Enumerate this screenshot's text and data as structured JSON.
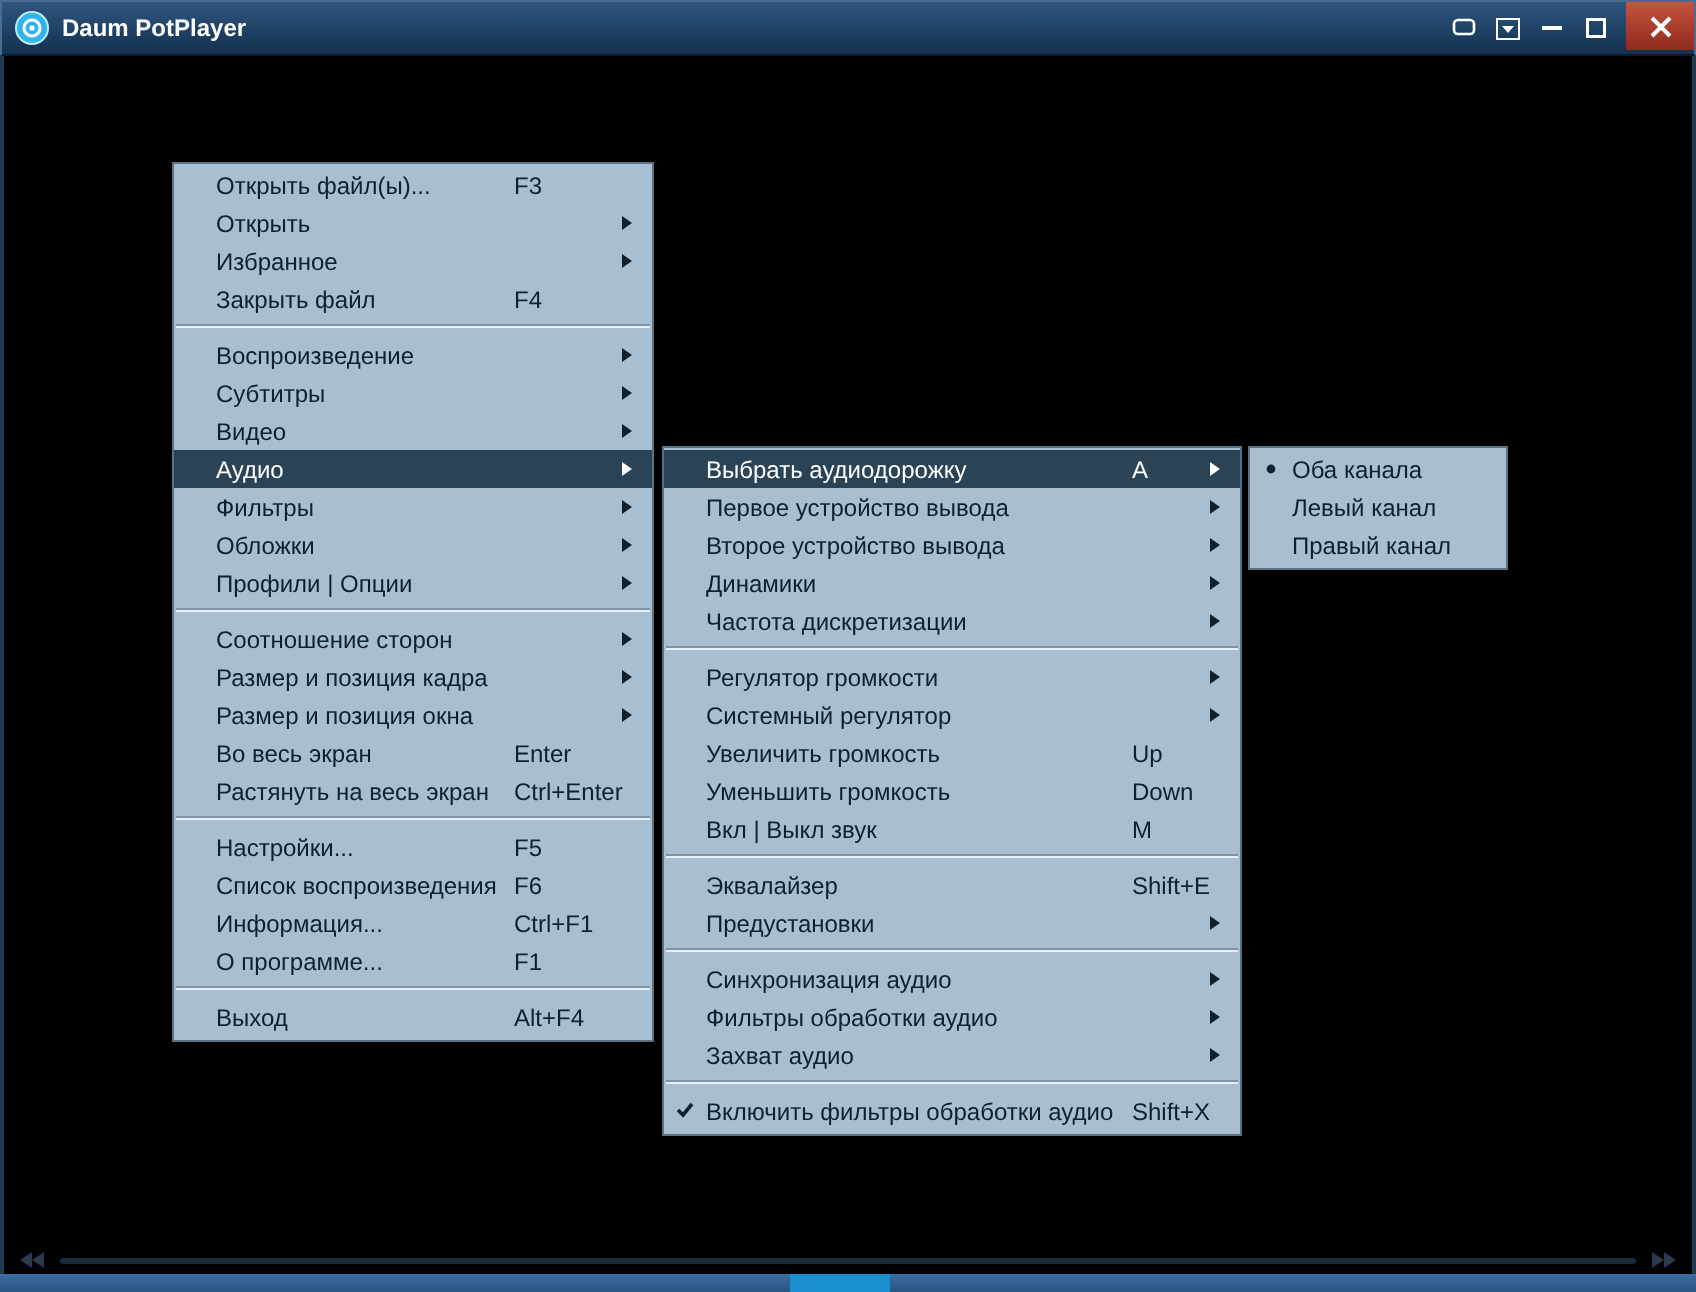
{
  "window": {
    "title": "Daum PotPlayer"
  },
  "main_menu": [
    {
      "kind": "item",
      "label": "Открыть файл(ы)...",
      "shortcut": "F3",
      "has_submenu": false,
      "selected": false
    },
    {
      "kind": "item",
      "label": "Открыть",
      "has_submenu": true,
      "selected": false
    },
    {
      "kind": "item",
      "label": "Избранное",
      "has_submenu": true,
      "selected": false
    },
    {
      "kind": "item",
      "label": "Закрыть файл",
      "shortcut": "F4",
      "has_submenu": false,
      "selected": false
    },
    {
      "kind": "separator"
    },
    {
      "kind": "item",
      "label": "Воспроизведение",
      "has_submenu": true,
      "selected": false
    },
    {
      "kind": "item",
      "label": "Субтитры",
      "has_submenu": true,
      "selected": false
    },
    {
      "kind": "item",
      "label": "Видео",
      "has_submenu": true,
      "selected": false
    },
    {
      "kind": "item",
      "label": "Аудио",
      "has_submenu": true,
      "selected": true
    },
    {
      "kind": "item",
      "label": "Фильтры",
      "has_submenu": true,
      "selected": false
    },
    {
      "kind": "item",
      "label": "Обложки",
      "has_submenu": true,
      "selected": false
    },
    {
      "kind": "item",
      "label": "Профили | Опции",
      "has_submenu": true,
      "selected": false
    },
    {
      "kind": "separator"
    },
    {
      "kind": "item",
      "label": "Соотношение сторон",
      "has_submenu": true,
      "selected": false
    },
    {
      "kind": "item",
      "label": "Размер и позиция кадра",
      "has_submenu": true,
      "selected": false
    },
    {
      "kind": "item",
      "label": "Размер и позиция окна",
      "has_submenu": true,
      "selected": false
    },
    {
      "kind": "item",
      "label": "Во весь экран",
      "shortcut": "Enter",
      "has_submenu": false,
      "selected": false
    },
    {
      "kind": "item",
      "label": "Растянуть на весь экран",
      "shortcut": "Ctrl+Enter",
      "has_submenu": false,
      "selected": false
    },
    {
      "kind": "separator"
    },
    {
      "kind": "item",
      "label": "Настройки...",
      "shortcut": "F5",
      "has_submenu": false,
      "selected": false
    },
    {
      "kind": "item",
      "label": "Список воспроизведения",
      "shortcut": "F6",
      "has_submenu": false,
      "selected": false
    },
    {
      "kind": "item",
      "label": "Информация...",
      "shortcut": "Ctrl+F1",
      "has_submenu": false,
      "selected": false
    },
    {
      "kind": "item",
      "label": "О программе...",
      "shortcut": "F1",
      "has_submenu": false,
      "selected": false
    },
    {
      "kind": "separator"
    },
    {
      "kind": "item",
      "label": "Выход",
      "shortcut": "Alt+F4",
      "has_submenu": false,
      "selected": false
    }
  ],
  "audio_menu": [
    {
      "kind": "item",
      "label": "Выбрать аудиодорожку",
      "shortcut": "A",
      "has_submenu": true,
      "selected": true,
      "checked": false
    },
    {
      "kind": "item",
      "label": "Первое устройство вывода",
      "has_submenu": true,
      "selected": false,
      "checked": false
    },
    {
      "kind": "item",
      "label": "Второе устройство вывода",
      "has_submenu": true,
      "selected": false,
      "checked": false
    },
    {
      "kind": "item",
      "label": "Динамики",
      "has_submenu": true,
      "selected": false,
      "checked": false
    },
    {
      "kind": "item",
      "label": "Частота дискретизации",
      "has_submenu": true,
      "selected": false,
      "checked": false
    },
    {
      "kind": "separator"
    },
    {
      "kind": "item",
      "label": "Регулятор громкости",
      "has_submenu": true,
      "selected": false,
      "checked": false
    },
    {
      "kind": "item",
      "label": "Системный регулятор",
      "has_submenu": true,
      "selected": false,
      "checked": false
    },
    {
      "kind": "item",
      "label": "Увеличить громкость",
      "shortcut": "Up",
      "has_submenu": false,
      "selected": false,
      "checked": false
    },
    {
      "kind": "item",
      "label": "Уменьшить громкость",
      "shortcut": "Down",
      "has_submenu": false,
      "selected": false,
      "checked": false
    },
    {
      "kind": "item",
      "label": "Вкл | Выкл звук",
      "shortcut": "M",
      "has_submenu": false,
      "selected": false,
      "checked": false
    },
    {
      "kind": "separator"
    },
    {
      "kind": "item",
      "label": "Эквалайзер",
      "shortcut": "Shift+E",
      "has_submenu": false,
      "selected": false,
      "checked": false
    },
    {
      "kind": "item",
      "label": "Предустановки",
      "has_submenu": true,
      "selected": false,
      "checked": false
    },
    {
      "kind": "separator"
    },
    {
      "kind": "item",
      "label": "Синхронизация аудио",
      "has_submenu": true,
      "selected": false,
      "checked": false
    },
    {
      "kind": "item",
      "label": "Фильтры обработки аудио",
      "has_submenu": true,
      "selected": false,
      "checked": false
    },
    {
      "kind": "item",
      "label": "Захват аудио",
      "has_submenu": true,
      "selected": false,
      "checked": false
    },
    {
      "kind": "separator"
    },
    {
      "kind": "item",
      "label": "Включить фильтры обработки аудио",
      "shortcut": "Shift+X",
      "has_submenu": false,
      "selected": false,
      "checked": true
    }
  ],
  "track_menu": [
    {
      "kind": "radio",
      "label": "Оба канала",
      "checked": true
    },
    {
      "kind": "radio",
      "label": "Левый канал",
      "checked": false
    },
    {
      "kind": "radio",
      "label": "Правый канал",
      "checked": false
    }
  ]
}
